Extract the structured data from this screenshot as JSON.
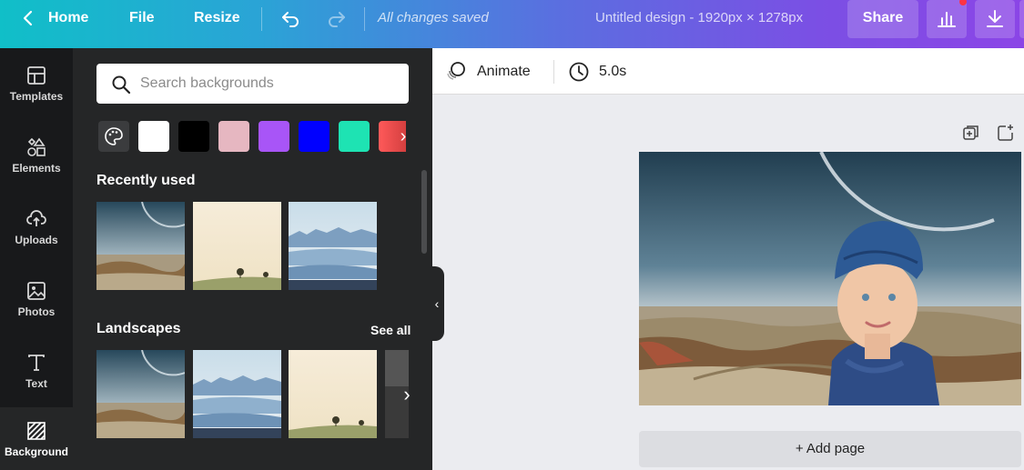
{
  "topbar": {
    "home_label": "Home",
    "file_label": "File",
    "resize_label": "Resize",
    "saved_status": "All changes saved",
    "design_title": "Untitled design - 1920px × 1278px",
    "share_label": "Share"
  },
  "siderail": {
    "items": [
      {
        "label": "Templates",
        "icon": "templates-icon"
      },
      {
        "label": "Elements",
        "icon": "elements-icon"
      },
      {
        "label": "Uploads",
        "icon": "uploads-icon"
      },
      {
        "label": "Photos",
        "icon": "photos-icon"
      },
      {
        "label": "Text",
        "icon": "text-icon"
      },
      {
        "label": "Background",
        "icon": "background-icon",
        "active": true
      }
    ]
  },
  "panel": {
    "search_placeholder": "Search backgrounds",
    "swatches": [
      "#ffffff",
      "#000000",
      "#e6b7c1",
      "#a855f7",
      "#0000ff",
      "#1ee3b3",
      "#ff5a5a"
    ],
    "recently_used_title": "Recently used",
    "landscapes_title": "Landscapes",
    "see_all_label": "See all"
  },
  "subbar": {
    "animate_label": "Animate",
    "duration_label": "5.0s"
  },
  "canvas": {
    "add_page_label": "+ Add page"
  }
}
